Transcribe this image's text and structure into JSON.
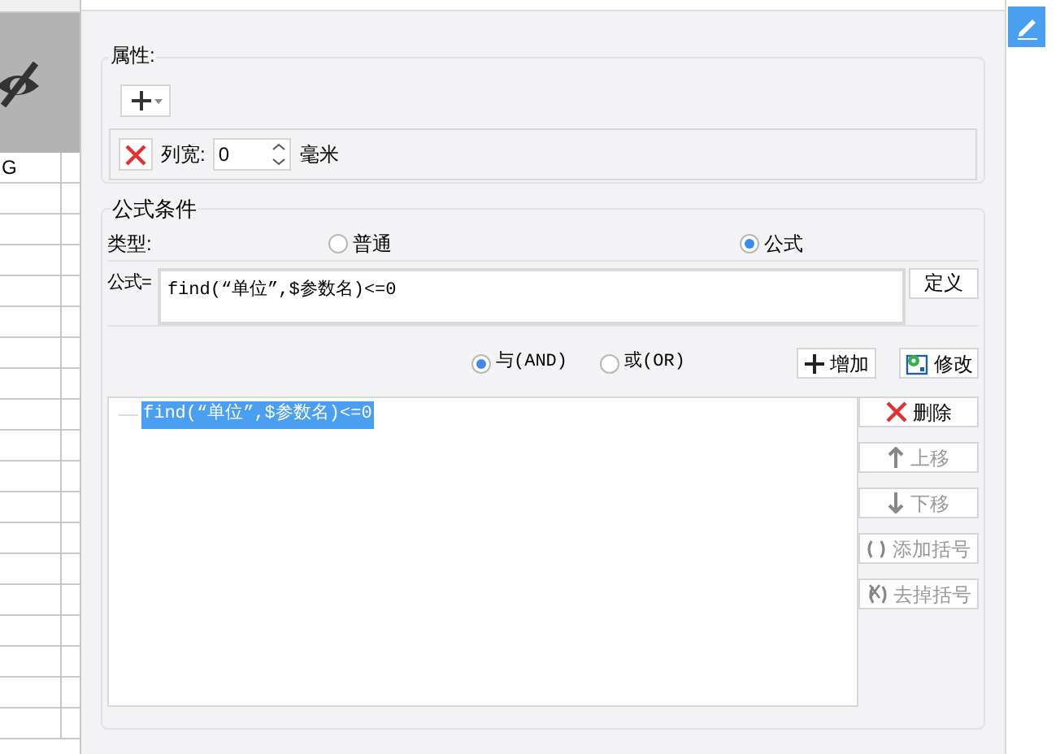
{
  "sheet": {
    "cell_text": "G"
  },
  "properties": {
    "title": "属性:",
    "column_width": {
      "label": "列宽:",
      "value": "0",
      "unit": "毫米"
    }
  },
  "condition": {
    "title": "公式条件",
    "type_label": "类型:",
    "types": [
      {
        "label": "普通",
        "selected": false
      },
      {
        "label": "公式",
        "selected": true
      }
    ],
    "formula_label": "公式=",
    "formula": "find(“单位”,$参数名)<=0",
    "define_button": "定义",
    "logic": [
      {
        "label": "与(AND)",
        "selected": true
      },
      {
        "label": "或(OR)",
        "selected": false
      }
    ],
    "actions": [
      {
        "kind": "add",
        "label": "增加"
      },
      {
        "kind": "edit",
        "label": "修改"
      }
    ],
    "items": [
      {
        "text": "find(“单位”,$参数名)<=0",
        "selected": true
      }
    ],
    "side_buttons": [
      {
        "kind": "delete",
        "label": "删除",
        "disabled": false
      },
      {
        "kind": "up",
        "label": "上移",
        "disabled": true
      },
      {
        "kind": "down",
        "label": "下移",
        "disabled": true
      },
      {
        "kind": "add_paren",
        "label": "添加括号",
        "disabled": true
      },
      {
        "kind": "remove_paren",
        "label": "去掉括号",
        "disabled": true
      }
    ]
  }
}
